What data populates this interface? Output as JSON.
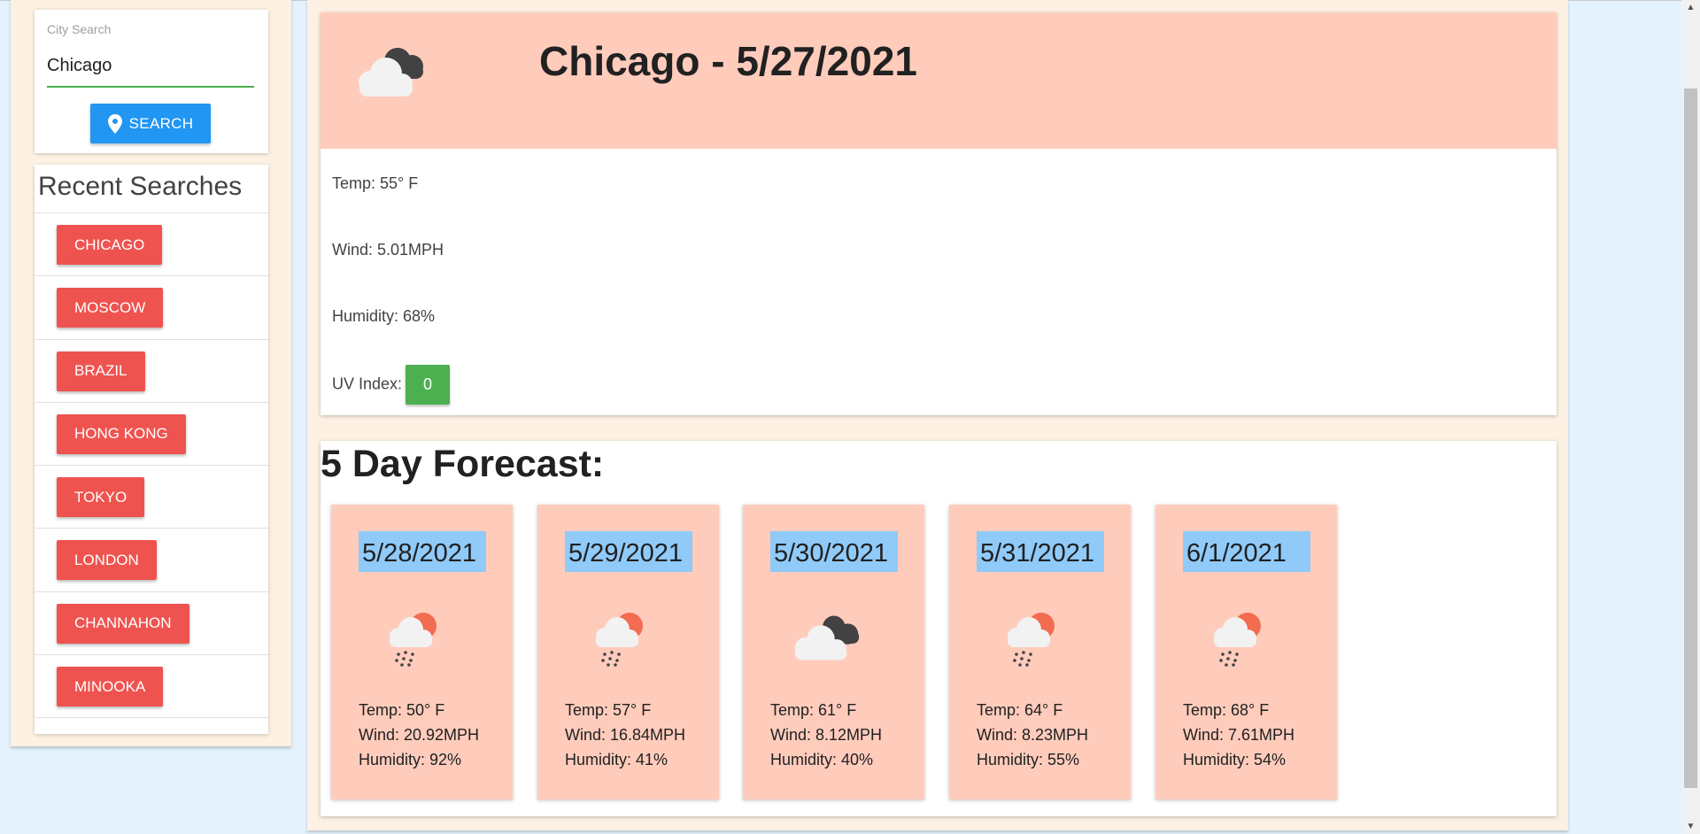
{
  "search": {
    "label": "City Search",
    "value": "Chicago",
    "button_label": "SEARCH",
    "button_icon": "map-pin-icon"
  },
  "recent": {
    "title": "Recent Searches",
    "items": [
      "CHICAGO",
      "MOSCOW",
      "BRAZIL",
      "HONG KONG",
      "TOKYO",
      "LONDON",
      "CHANNAHON",
      "MINOOKA"
    ]
  },
  "today": {
    "title": "Chicago - 5/27/2021",
    "icon": "cloudy-icon",
    "temp": "Temp: 55° F",
    "wind": "Wind: 5.01MPH",
    "humidity": "Humidity: 68%",
    "uv_label": "UV Index:",
    "uv_value": "0",
    "uv_color": "#4caf50"
  },
  "forecast": {
    "title": "5 Day Forecast:",
    "days": [
      {
        "date": "5/28/2021",
        "icon": "rain-sun-icon",
        "temp": "Temp: 50° F",
        "wind": "Wind: 20.92MPH",
        "humidity": "Humidity: 92%"
      },
      {
        "date": "5/29/2021",
        "icon": "rain-sun-icon",
        "temp": "Temp: 57° F",
        "wind": "Wind: 16.84MPH",
        "humidity": "Humidity: 41%"
      },
      {
        "date": "5/30/2021",
        "icon": "cloudy-icon",
        "temp": "Temp: 61° F",
        "wind": "Wind: 8.12MPH",
        "humidity": "Humidity: 40%"
      },
      {
        "date": "5/31/2021",
        "icon": "rain-sun-icon",
        "temp": "Temp: 64° F",
        "wind": "Wind: 8.23MPH",
        "humidity": "Humidity: 55%"
      },
      {
        "date": "6/1/2021",
        "icon": "rain-sun-icon",
        "temp": "Temp: 68° F",
        "wind": "Wind: 7.61MPH",
        "humidity": "Humidity: 54%"
      }
    ]
  },
  "colors": {
    "header_bg": "#ffccbc",
    "date_bg": "#90caf9",
    "recent_btn": "#ef5350",
    "search_btn": "#2196f3"
  }
}
